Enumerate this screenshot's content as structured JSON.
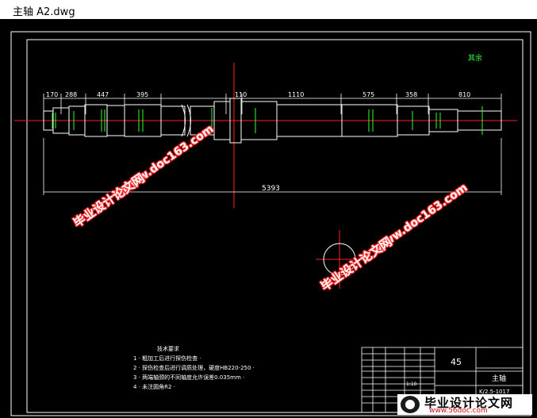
{
  "window": {
    "title": "主轴 A2.dwg"
  },
  "drawing": {
    "roughness_note": "其余",
    "dimensions": {
      "d170": "170",
      "d288": "288",
      "d447": "447",
      "d395": "395",
      "d110a": "110",
      "d1110": "1110",
      "d575": "575",
      "d358": "358",
      "d810": "810",
      "d5393": "5393"
    },
    "tech_requirements": {
      "title": "技术要求",
      "items": [
        "1 · 粗加工后进行探伤检查 ·",
        "2 · 探伤检查后进行调质处理，硬度HB220-250 ·",
        "3 · 两端轴颈的不同轴度允许误差0.035mm ·",
        "4 · 未注圆角R2 ·"
      ]
    },
    "title_block": {
      "material": "45",
      "part_name": "主轴",
      "drawing_no": "K/2.5-1017",
      "scale": "1:10"
    }
  },
  "watermarks": {
    "site": "www.doc163.com",
    "brand": "毕业设计论文网",
    "logo_brand": "毕业设计论文网",
    "logo_site": "www.56doc.com"
  }
}
